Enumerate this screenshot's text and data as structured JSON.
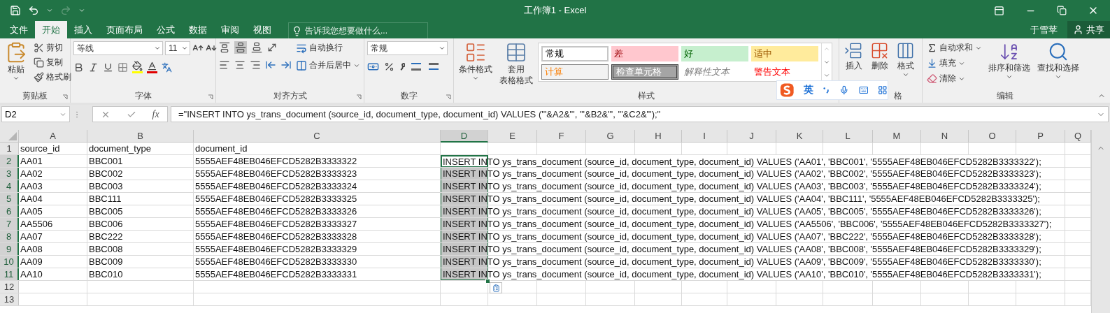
{
  "window": {
    "title": "工作簿1 - Excel"
  },
  "tabs": [
    {
      "label": "文件",
      "selected": false
    },
    {
      "label": "开始",
      "selected": true
    },
    {
      "label": "插入",
      "selected": false
    },
    {
      "label": "页面布局",
      "selected": false
    },
    {
      "label": "公式",
      "selected": false
    },
    {
      "label": "数据",
      "selected": false
    },
    {
      "label": "审阅",
      "selected": false
    },
    {
      "label": "视图",
      "selected": false
    }
  ],
  "tell_me": {
    "placeholder": "告诉我您想要做什么..."
  },
  "account": {
    "user": "于雪苹",
    "share": "共享"
  },
  "ribbon": {
    "clipboard": {
      "label": "剪贴板",
      "paste": "粘贴",
      "items": [
        "剪切",
        "复制",
        "格式刷"
      ]
    },
    "font": {
      "label": "字体",
      "font_name": "等线",
      "font_size": "11"
    },
    "alignment": {
      "label": "对齐方式",
      "wrap_text": "自动换行",
      "merge_center": "合并后居中"
    },
    "number": {
      "label": "数字",
      "format": "常规"
    },
    "styles": {
      "label": "样式",
      "conditional": "条件格式",
      "table_format": [
        "套用",
        "表格格式"
      ],
      "cell_styles": [
        {
          "label": "常规",
          "kind": "normal"
        },
        {
          "label": "差",
          "kind": "bad"
        },
        {
          "label": "好",
          "kind": "good"
        },
        {
          "label": "适中",
          "kind": "neutral"
        },
        {
          "label": "计算",
          "kind": "calculation"
        },
        {
          "label": "检查单元格",
          "kind": "check"
        },
        {
          "label": "解释性文本",
          "kind": "explanatory"
        },
        {
          "label": "警告文本",
          "kind": "warning"
        }
      ]
    },
    "cells": {
      "label": "格",
      "items": [
        "插入",
        "删除",
        "格式"
      ]
    },
    "editing": {
      "label": "编辑",
      "autosum": "自动求和",
      "fill": "填充",
      "clear": "清除",
      "sort_filter": "排序和筛选",
      "find_select": "查找和选择"
    }
  },
  "ime_toolbar": {
    "mode": "英"
  },
  "formula_bar": {
    "name_box": "D2",
    "fx": "fx",
    "formula": "=\"INSERT INTO ys_trans_document (source_id, document_type, document_id) VALUES ('\"&A2&\"', '\"&B2&\"', '\"&C2&\"');\""
  },
  "columns": [
    {
      "label": "A",
      "selected": false
    },
    {
      "label": "B",
      "selected": false
    },
    {
      "label": "C",
      "selected": false
    },
    {
      "label": "D",
      "selected": true
    },
    {
      "label": "E",
      "selected": false
    },
    {
      "label": "F",
      "selected": false
    },
    {
      "label": "G",
      "selected": false
    },
    {
      "label": "H",
      "selected": false
    },
    {
      "label": "I",
      "selected": false
    },
    {
      "label": "J",
      "selected": false
    },
    {
      "label": "K",
      "selected": false
    },
    {
      "label": "L",
      "selected": false
    },
    {
      "label": "M",
      "selected": false
    },
    {
      "label": "N",
      "selected": false
    },
    {
      "label": "O",
      "selected": false
    },
    {
      "label": "P",
      "selected": false
    },
    {
      "label": "Q",
      "selected": false
    }
  ],
  "rows": [
    {
      "number": "1",
      "selected": false,
      "active": false,
      "cells": [
        "source_id",
        "document_type",
        "document_id"
      ]
    },
    {
      "number": "2",
      "selected": true,
      "active": true,
      "cells": [
        "AA01",
        "BBC001",
        "5555AEF48EB046EFCD5282B3333322"
      ],
      "d": "INSERT INTO ys_trans_document (source_id, document_type, document_id) VALUES ('AA01', 'BBC001', '5555AEF48EB046EFCD5282B3333322');"
    },
    {
      "number": "3",
      "selected": true,
      "active": false,
      "cells": [
        "AA02",
        "BBC002",
        "5555AEF48EB046EFCD5282B3333323"
      ],
      "d": "INSERT INTO ys_trans_document (source_id, document_type, document_id) VALUES ('AA02', 'BBC002', '5555AEF48EB046EFCD5282B3333323');"
    },
    {
      "number": "4",
      "selected": true,
      "active": false,
      "cells": [
        "AA03",
        "BBC003",
        "5555AEF48EB046EFCD5282B3333324"
      ],
      "d": "INSERT INTO ys_trans_document (source_id, document_type, document_id) VALUES ('AA03', 'BBC003', '5555AEF48EB046EFCD5282B3333324');"
    },
    {
      "number": "5",
      "selected": true,
      "active": false,
      "cells": [
        "AA04",
        "BBC111",
        "5555AEF48EB046EFCD5282B3333325"
      ],
      "d": "INSERT INTO ys_trans_document (source_id, document_type, document_id) VALUES ('AA04', 'BBC111', '5555AEF48EB046EFCD5282B3333325');"
    },
    {
      "number": "6",
      "selected": true,
      "active": false,
      "cells": [
        "AA05",
        "BBC005",
        "5555AEF48EB046EFCD5282B3333326"
      ],
      "d": "INSERT INTO ys_trans_document (source_id, document_type, document_id) VALUES ('AA05', 'BBC005', '5555AEF48EB046EFCD5282B3333326');"
    },
    {
      "number": "7",
      "selected": true,
      "active": false,
      "cells": [
        "AA5506",
        "BBC006",
        "5555AEF48EB046EFCD5282B3333327"
      ],
      "d": "INSERT INTO ys_trans_document (source_id, document_type, document_id) VALUES ('AA5506', 'BBC006', '5555AEF48EB046EFCD5282B3333327');"
    },
    {
      "number": "8",
      "selected": true,
      "active": false,
      "cells": [
        "AA07",
        "BBC222",
        "5555AEF48EB046EFCD5282B3333328"
      ],
      "d": "INSERT INTO ys_trans_document (source_id, document_type, document_id) VALUES ('AA07', 'BBC222', '5555AEF48EB046EFCD5282B3333328');"
    },
    {
      "number": "9",
      "selected": true,
      "active": false,
      "cells": [
        "AA08",
        "BBC008",
        "5555AEF48EB046EFCD5282B3333329"
      ],
      "d": "INSERT INTO ys_trans_document (source_id, document_type, document_id) VALUES ('AA08', 'BBC008', '5555AEF48EB046EFCD5282B3333329');"
    },
    {
      "number": "10",
      "selected": true,
      "active": false,
      "cells": [
        "AA09",
        "BBC009",
        "5555AEF48EB046EFCD5282B3333330"
      ],
      "d": "INSERT INTO ys_trans_document (source_id, document_type, document_id) VALUES ('AA09', 'BBC009', '5555AEF48EB046EFCD5282B3333330');"
    },
    {
      "number": "11",
      "selected": true,
      "active": false,
      "cells": [
        "AA10",
        "BBC010",
        "5555AEF48EB046EFCD5282B3333331"
      ],
      "d": "INSERT INTO ys_trans_document (source_id, document_type, document_id) VALUES ('AA10', 'BBC010', '5555AEF48EB046EFCD5282B3333331');"
    },
    {
      "number": "12",
      "selected": false,
      "active": false
    },
    {
      "number": "13",
      "selected": false,
      "active": false
    }
  ]
}
